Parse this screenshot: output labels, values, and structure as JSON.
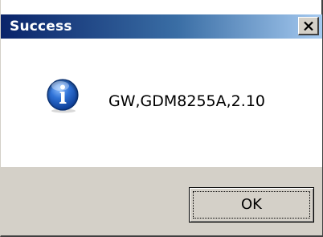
{
  "dialog": {
    "title": "Success",
    "close_icon": "close-icon",
    "message_icon": "information-icon",
    "message": "GW,GDM8255A,2.10",
    "ok_label": "OK"
  },
  "colors": {
    "titlebar_start": "#0a246a",
    "titlebar_end": "#a6caf0",
    "title_text": "#ffffff",
    "content_bg": "#ffffff",
    "footer_bg": "#d4d0c8",
    "icon_blue": "#1f5fbf"
  }
}
